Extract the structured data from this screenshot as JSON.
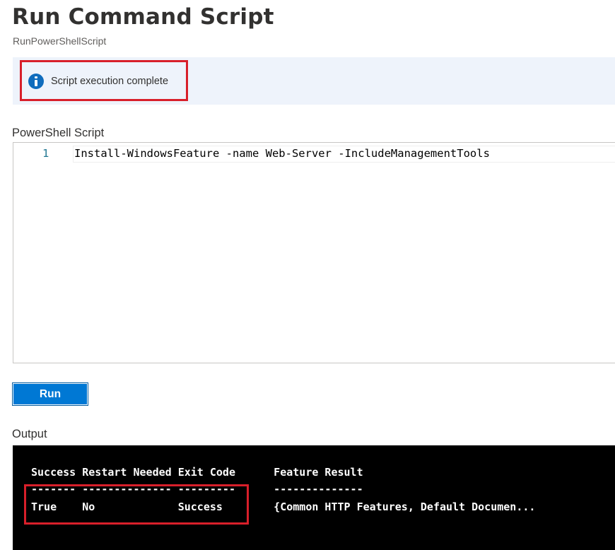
{
  "page": {
    "title": "Run Command Script",
    "subtitle": "RunPowerShellScript"
  },
  "notification": {
    "icon": "info-icon",
    "message": "Script execution complete",
    "accent": "#0f6cbd",
    "highlight_color": "#d81f2a"
  },
  "script": {
    "label": "PowerShell Script",
    "lines": [
      {
        "number": "1",
        "code": "Install-WindowsFeature -name Web-Server -IncludeManagementTools"
      }
    ]
  },
  "run_button": {
    "label": "Run",
    "color": "#0078d4"
  },
  "output": {
    "label": "Output",
    "header": "Success Restart Needed Exit Code      Feature Result",
    "separator": "------- -------------- ---------      --------------",
    "result_row": "True    No             Success        {Common HTTP Features, Default Documen..."
  }
}
